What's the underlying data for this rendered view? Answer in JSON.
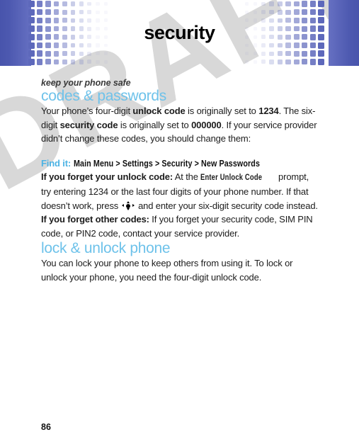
{
  "header": {
    "title": "security",
    "band_color_dark": "#4854ac",
    "band_color_light": "#6670c2",
    "square_color": "#5d68bb"
  },
  "watermark": {
    "text": "DRAFT",
    "color": "#d8d8d8"
  },
  "content": {
    "subtitle": "keep your phone safe",
    "heading_codes": "codes & passwords",
    "heading_lock": "lock & unlock phone",
    "accent_color": "#6ec2ea",
    "intro": {
      "part1": "Your phone’s four-digit ",
      "bold1": "unlock code",
      "part2": " is originally set to ",
      "bold2": "1234",
      "part3": ". The six-digit ",
      "bold3": "security code",
      "part4": " is originally set to ",
      "bold4": "000000",
      "part5": ". If your service provider didn’t change these codes, you should change them:"
    },
    "find_it": {
      "label": "Find it:",
      "path": "Main Menu > Settings > Security > New Passwords"
    },
    "forget_unlock": {
      "bold_lead": "If you forget your unlock code:",
      "part1": " At the ",
      "ui_label": "Enter Unlock Code",
      "part2": " prompt, try entering 1234 or the last four digits of your phone number. If that doesn’t work, press ",
      "part3": " and enter your six-digit security code instead."
    },
    "forget_other": {
      "bold_lead": "If you forget other codes:",
      "text": " If you forget your security code, SIM PIN code, or PIN2 code, contact your service provider."
    },
    "lock_body": "You can lock your phone to keep others from using it. To lock or unlock your phone, you need the four-digit unlock code."
  },
  "footer": {
    "page_number": "86"
  }
}
